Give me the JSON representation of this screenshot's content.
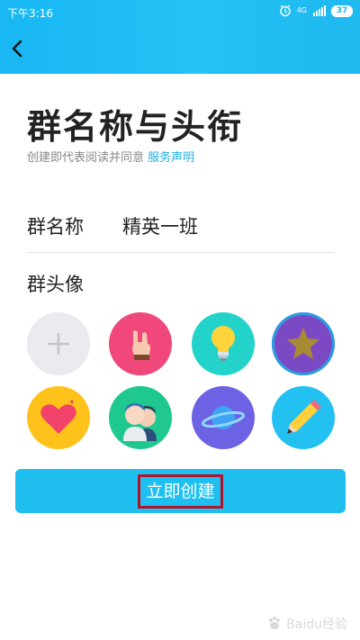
{
  "status_bar": {
    "time": "下午3:16",
    "network": "4G",
    "battery": "37"
  },
  "header": {
    "back_icon": "chevron-left-icon"
  },
  "page": {
    "title": "群名称与头衔",
    "subtitle_prefix": "创建即代表阅读并同意",
    "subtitle_link": "服务声明"
  },
  "form": {
    "name_label": "群名称",
    "name_value": "精英一班",
    "avatar_label": "群头像"
  },
  "avatars": [
    {
      "id": "add",
      "icon": "plus-icon",
      "bg": "#ebebef"
    },
    {
      "id": "rock-hand",
      "icon": "rock-hand-icon",
      "bg": "#f0487a"
    },
    {
      "id": "lightbulb",
      "icon": "lightbulb-icon",
      "bg": "#23d3c9"
    },
    {
      "id": "star",
      "icon": "star-icon",
      "bg": "#7b49c4",
      "selected": true
    },
    {
      "id": "heart",
      "icon": "heart-icon",
      "bg": "#ffc21a"
    },
    {
      "id": "people",
      "icon": "people-icon",
      "bg": "#1ec88f"
    },
    {
      "id": "planet",
      "icon": "planet-icon",
      "bg": "#6d61e4"
    },
    {
      "id": "pencil",
      "icon": "pencil-icon",
      "bg": "#23c0f2"
    }
  ],
  "actions": {
    "create_label": "立即创建"
  },
  "colors": {
    "accent": "#1fc0f0",
    "link": "#1faee8",
    "highlight_box": "#b3122a"
  },
  "watermark": "Baidu经验"
}
